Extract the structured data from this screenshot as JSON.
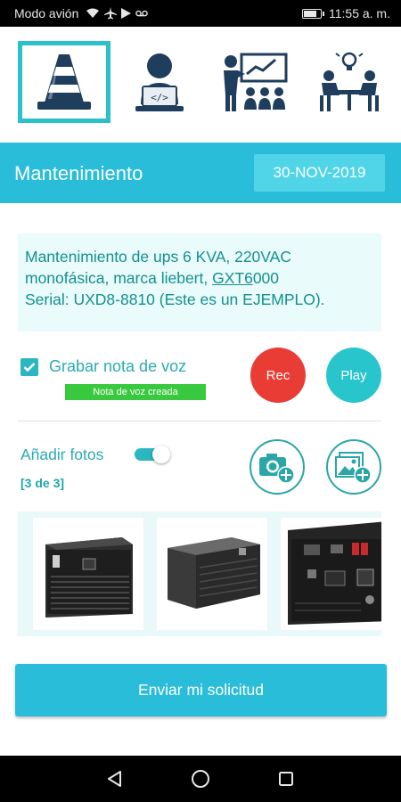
{
  "status_bar": {
    "carrier": "Modo avión",
    "time": "11:55 a. m.",
    "battery_level": 0.85
  },
  "categories": [
    {
      "name": "maintenance",
      "icon": "traffic-cone-icon",
      "active": true
    },
    {
      "name": "developer",
      "icon": "developer-laptop-icon",
      "active": false
    },
    {
      "name": "training",
      "icon": "presentation-board-icon",
      "active": false
    },
    {
      "name": "consulting",
      "icon": "meeting-idea-icon",
      "active": false
    }
  ],
  "header": {
    "title": "Mantenimiento",
    "date": "30-NOV-2019"
  },
  "description": {
    "line1": "Mantenimiento de ups 6 KVA, 220VAC",
    "line2_prefix": "monofásica, marca liebert, ",
    "line2_link": "GXT6",
    "line2_suffix": "000",
    "line3": "Serial: UXD8-8810 (Este es un EJEMPLO)."
  },
  "voice_note": {
    "checked": true,
    "label": "Grabar nota de voz",
    "badge": "Nota de voz creada",
    "rec_label": "Rec",
    "play_label": "Play"
  },
  "photos": {
    "label": "Añadir fotos",
    "toggle_on": true,
    "count": "[3 de 3]",
    "items": [
      {
        "name": "ups-tower-photo"
      },
      {
        "name": "ups-rack-photo"
      },
      {
        "name": "ups-rear-photo"
      }
    ]
  },
  "submit": {
    "label": "Enviar mi solicitud"
  },
  "colors": {
    "accent": "#29bdd9",
    "teal_text": "#2aaab4",
    "rec": "#e83c35",
    "badge_green": "#39c93e"
  }
}
